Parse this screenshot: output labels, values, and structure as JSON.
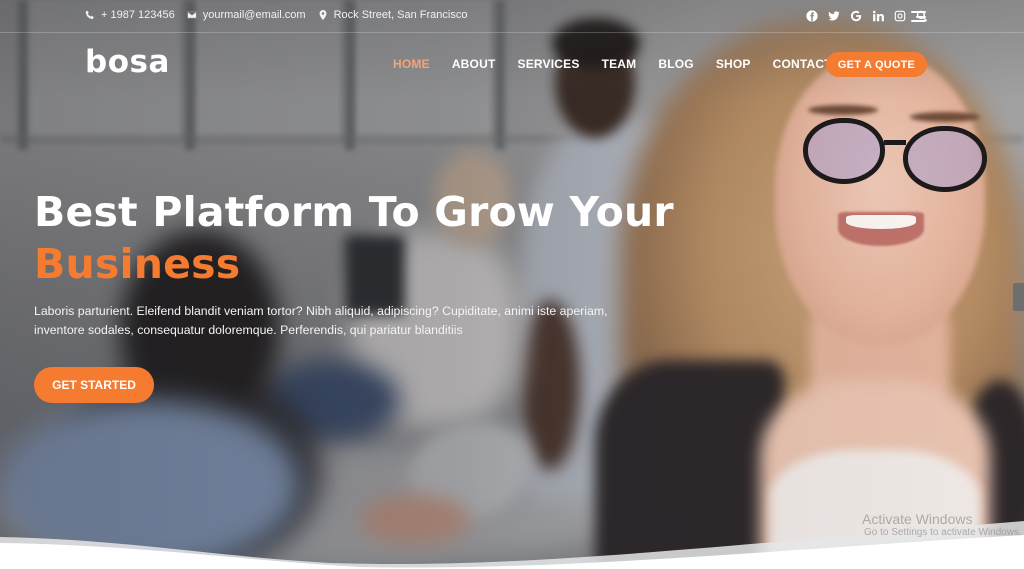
{
  "topbar": {
    "phone": "+ 1987 123456",
    "email": "yourmail@email.com",
    "address": "Rock Street, San Francisco",
    "social_icons": [
      "facebook-icon",
      "twitter-icon",
      "google-icon",
      "linkedin-icon",
      "instagram-icon"
    ],
    "utility_icons": [
      "search-icon",
      "menu-icon"
    ]
  },
  "header": {
    "logo": "bosa",
    "nav": [
      {
        "label": "HOME",
        "active": true
      },
      {
        "label": "ABOUT",
        "active": false
      },
      {
        "label": "SERVICES",
        "active": false
      },
      {
        "label": "TEAM",
        "active": false
      },
      {
        "label": "BLOG",
        "active": false
      },
      {
        "label": "SHOP",
        "active": false
      },
      {
        "label": "CONTACT",
        "active": false
      }
    ],
    "cta_label": "GET A QUOTE"
  },
  "hero": {
    "headline_line1": "Best Platform To Grow Your",
    "headline_accent": "Business",
    "lead": "Laboris parturient. Eleifend blandit veniam tortor? Nibh aliquid, adipiscing? Cupiditate, animi iste aperiam, inventore sodales, consequatur doloremque. Perferendis, qui pariatur blanditiis",
    "cta_label": "GET STARTED"
  },
  "watermark": {
    "line1": "Activate Windows",
    "line2": "Go to Settings to activate Windows."
  },
  "colors": {
    "accent": "#f47b30",
    "nav_active": "#f4a479",
    "text_light": "#ffffff"
  }
}
